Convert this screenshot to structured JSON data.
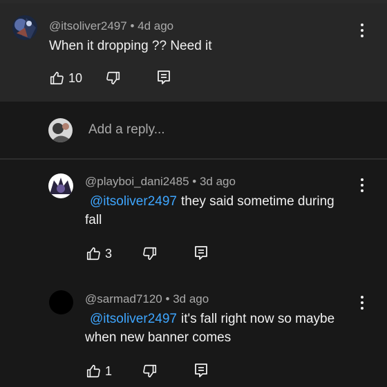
{
  "main": {
    "author": "@itsoliver2497",
    "age": "4d ago",
    "separator": "•",
    "text": "When it dropping ?? Need it",
    "likes": "10"
  },
  "reply_box": {
    "placeholder": "Add a reply..."
  },
  "replies": [
    {
      "author": "@playboi_dani2485",
      "age": "3d ago",
      "mention": "@itsoliver2497",
      "text_line1": "they said sometime during",
      "text_line2": "fall",
      "likes": "3"
    },
    {
      "author": "@sarmad7120",
      "age": "3d ago",
      "mention": "@itsoliver2497",
      "text_line1": "it's fall right now so maybe",
      "text_line2": "when new banner comes",
      "likes": "1"
    }
  ],
  "colors": {
    "background": "#181818",
    "highlight": "#272727",
    "mention": "#3ea6ff",
    "meta": "#aaaaaa",
    "text": "#f1f1f1"
  },
  "icons": [
    "thumbs-up-icon",
    "thumbs-down-icon",
    "reply-icon",
    "more-vert-icon"
  ]
}
